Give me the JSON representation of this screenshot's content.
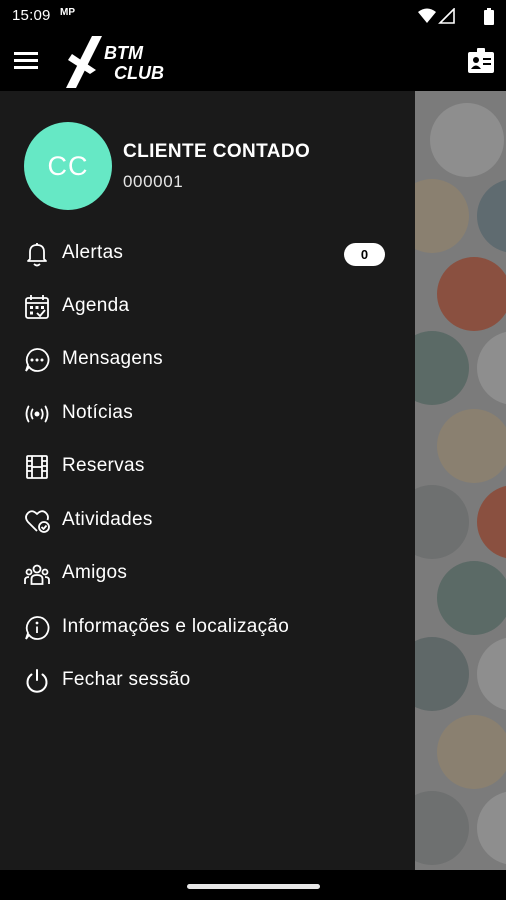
{
  "status_bar": {
    "time": "15:09",
    "notification": "MP",
    "icons": [
      "wifi-icon",
      "signal-icon",
      "battery-icon"
    ]
  },
  "app_bar": {
    "logo_line1": "BTM",
    "logo_line2": "CLUB",
    "icons": [
      "hamburger-menu-icon",
      "member-card-icon"
    ]
  },
  "user": {
    "initials": "CC",
    "name": "CLIENTE CONTADO",
    "id": "000001",
    "avatar_color": "#66e8c5"
  },
  "menu": [
    {
      "label": "Alertas",
      "icon": "bell-icon",
      "badge": "0"
    },
    {
      "label": "Agenda",
      "icon": "calendar-icon"
    },
    {
      "label": "Mensagens",
      "icon": "chat-bubble-icon"
    },
    {
      "label": "Notícias",
      "icon": "broadcast-icon"
    },
    {
      "label": "Reservas",
      "icon": "film-strip-icon"
    },
    {
      "label": "Atividades",
      "icon": "heart-check-icon"
    },
    {
      "label": "Amigos",
      "icon": "people-icon"
    },
    {
      "label": "Informações e localização",
      "icon": "info-bubble-icon"
    },
    {
      "label": "Fechar sessão",
      "icon": "power-icon"
    }
  ],
  "colors": {
    "drawer_bg": "#1a1a1a",
    "scrim": "#7b7b7b",
    "accent": "#66e8c5"
  }
}
